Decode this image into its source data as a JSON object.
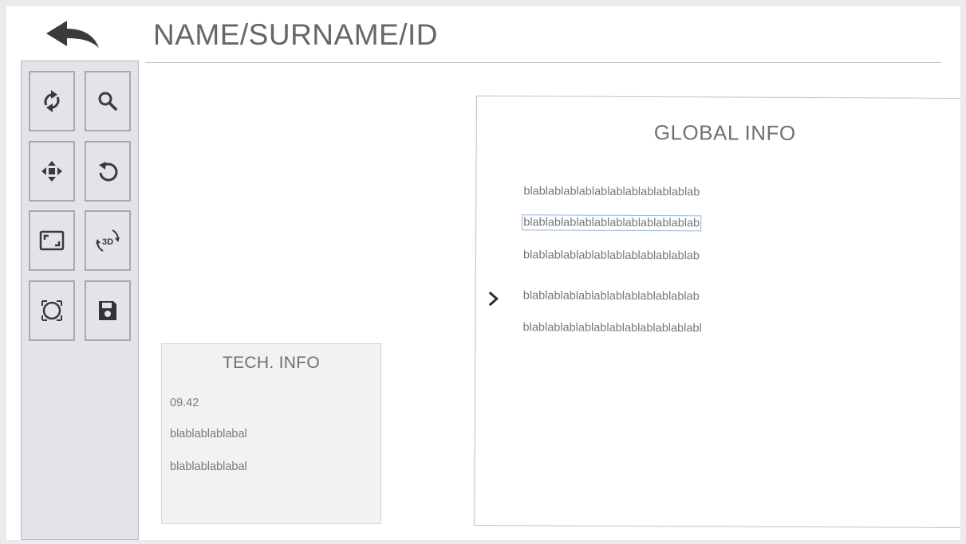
{
  "header": {
    "title": "NAME/SURNAME/ID",
    "back_icon": "back-arrow-icon"
  },
  "toolbar": {
    "tools": [
      {
        "id": "refresh",
        "icon": "refresh-icon"
      },
      {
        "id": "search",
        "icon": "search-icon"
      },
      {
        "id": "move",
        "icon": "move-icon"
      },
      {
        "id": "undo",
        "icon": "undo-icon"
      },
      {
        "id": "fit-screen",
        "icon": "fit-screen-icon"
      },
      {
        "id": "rotate-3d",
        "icon": "rotate-3d-icon",
        "label": "3D"
      },
      {
        "id": "ellipse-select",
        "icon": "ellipse-select-icon"
      },
      {
        "id": "save",
        "icon": "save-icon"
      }
    ]
  },
  "tech_info": {
    "title": "TECH. INFO",
    "lines": [
      "09.42",
      "blablablablabal",
      "blablablablabal"
    ]
  },
  "global_info": {
    "title": "GLOBAL INFO",
    "lines": [
      "blablablablablablablablablablablab",
      "blablablablablablablablablablablab",
      "blablablablablablablablablablablab",
      "blablablablablablablablablablablab",
      "blablablablablablablablablablablabl"
    ],
    "expand_icon": "chevron-right-icon"
  },
  "colors": {
    "sidebar_bg": "#e3e3e9",
    "tool_border": "#a9a9ad",
    "icon": "#3a3a3a",
    "text": "#777777",
    "selection_outline": "#8fb8e4"
  }
}
